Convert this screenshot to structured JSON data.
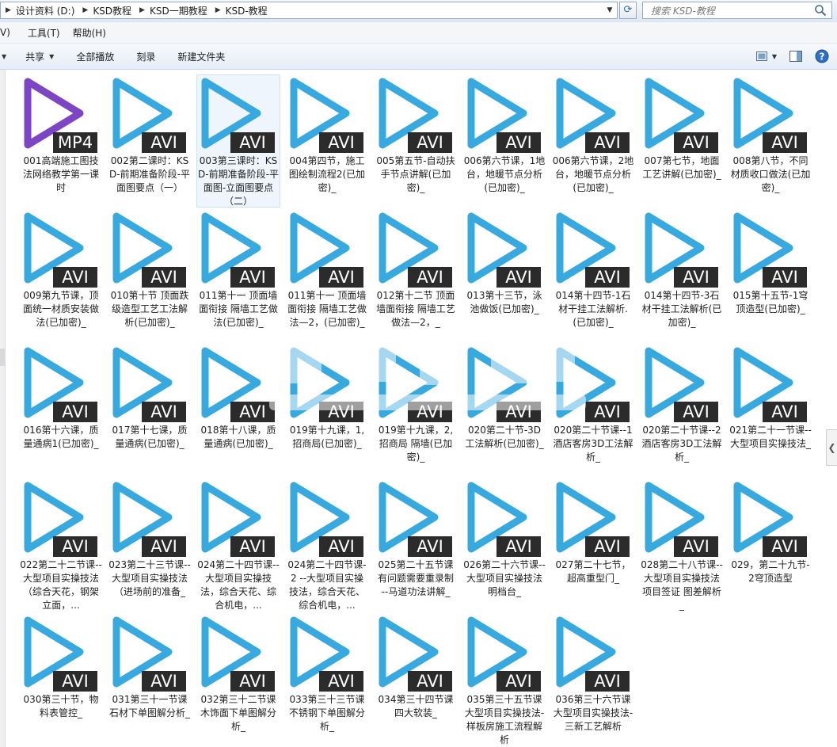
{
  "address": {
    "breadcrumbs": [
      "设计资料 (D:)",
      "KSD教程",
      "KSD一期教程",
      "KSD-教程"
    ]
  },
  "search": {
    "placeholder": "搜索 KSD-教程"
  },
  "menu": {
    "items": [
      "V)",
      "工具(T)",
      "帮助(H)"
    ]
  },
  "toolbar": {
    "share_label": "共享",
    "play_all_label": "全部播放",
    "burn_label": "刻录",
    "new_folder_label": "新建文件夹"
  },
  "colors": {
    "play_blue": "#38a9df",
    "mp4_purple": "#7b45c4",
    "badge_bg": "#2b2b2b"
  },
  "files": [
    {
      "name": "001高端施工图技法网络教学第一课时",
      "type": "MP4"
    },
    {
      "name": "002第二课时：KSD-前期准备阶段-平面图要点（一）",
      "type": "AVI"
    },
    {
      "name": "003第三课时：KSD-前期准备阶段-平面图-立面图要点（二）",
      "type": "AVI",
      "selected": true
    },
    {
      "name": "004第四节，施工图绘制流程2(已加密)_",
      "type": "AVI"
    },
    {
      "name": "005第五节-自动扶手节点讲解(已加密)_",
      "type": "AVI"
    },
    {
      "name": "006第六节课，1地台，地暖节点分析(已加密)_",
      "type": "AVI"
    },
    {
      "name": "006第六节课，2地台，地暖节点分析(已加密)_",
      "type": "AVI"
    },
    {
      "name": "007第七节，地面工艺讲解(已加密)_",
      "type": "AVI"
    },
    {
      "name": "008第八节，不同材质收口做法(已加密)_",
      "type": "AVI"
    },
    {
      "name": "009第九节课，顶面统一材质安装做法(已加密)_",
      "type": "AVI"
    },
    {
      "name": "010第十节 顶面跌级造型工艺工法解析(已加密)_",
      "type": "AVI"
    },
    {
      "name": "011第十一 顶面墙面衔接 隔墙工艺做法(已加密)_",
      "type": "AVI"
    },
    {
      "name": "011第十一 顶面墙面衔接 隔墙工艺做法—2，(已加密)_",
      "type": "AVI"
    },
    {
      "name": "012第十二节 顶面墙面衔接 隔墙工艺做法—2，_",
      "type": "AVI"
    },
    {
      "name": "013第十三节，泳池做饭(已加密)_",
      "type": "AVI"
    },
    {
      "name": "014第十四节-1石材干挂工法解析.(已加密)_",
      "type": "AVI"
    },
    {
      "name": "014第十四节-3石材干挂工法解析(已加密)_",
      "type": "AVI"
    },
    {
      "name": "015第十五节-1穹顶造型(已加密)_",
      "type": "AVI"
    },
    {
      "name": "016第十六课，质量通病1(已加密)_",
      "type": "AVI"
    },
    {
      "name": "017第十七课，质量通病(已加密)_",
      "type": "AVI"
    },
    {
      "name": "018第十八课，质量通病(已加密)_",
      "type": "AVI"
    },
    {
      "name": "019第十九课，1,招商局(已加密)_",
      "type": "AVI"
    },
    {
      "name": "019第十九课，2,招商局 隔墙(已加密)_",
      "type": "AVI"
    },
    {
      "name": "020第二十节-3D工法解析(已加密)_",
      "type": "AVI"
    },
    {
      "name": "020第二十节课--1酒店客房3D工法解析_",
      "type": "AVI"
    },
    {
      "name": "020第二十节课--2酒店客房3D工法解析_",
      "type": "AVI"
    },
    {
      "name": "021第二十一节课--大型项目实操技法_",
      "type": "AVI"
    },
    {
      "name": "022第二十二节课--大型项目实操技法（综合天花，钢架立面，...",
      "type": "AVI"
    },
    {
      "name": "023第二十三节课--大型项目实操技法（进场前的准备_",
      "type": "AVI"
    },
    {
      "name": "024第二十四节课--大型项目实操技法，综合天花、综合机电，...",
      "type": "AVI"
    },
    {
      "name": "024第二十四节课-2 --大型项目实操技法，综合天花、综合机电，...",
      "type": "AVI"
    },
    {
      "name": "025第二十五节课 有问题需要重录制 --马道功法讲解_",
      "type": "AVI"
    },
    {
      "name": "026第二十六节课--大型项目实操技法明档台_",
      "type": "AVI"
    },
    {
      "name": "027第二十七节，超高重型门_",
      "type": "AVI"
    },
    {
      "name": "028第二十八节课--大型项目实操技法项目签证 图差解析_",
      "type": "AVI"
    },
    {
      "name": "029，第二十九节-2穹顶造型",
      "type": "AVI"
    },
    {
      "name": "030第三十节，物料表管控_",
      "type": "AVI"
    },
    {
      "name": "031第三十一节课石材下单图解分析_",
      "type": "AVI"
    },
    {
      "name": "032第三十二节课木饰面下单图解分析_",
      "type": "AVI"
    },
    {
      "name": "033第三十三节课不锈钢下单图解分析_",
      "type": "AVI"
    },
    {
      "name": "034第三十四节课四大软装_",
      "type": "AVI"
    },
    {
      "name": "035第三十五节课大型项目实操技法-样板房施工流程解析",
      "type": "AVI"
    },
    {
      "name": "036第三十六节课大型项目实操技法-三新工艺解析",
      "type": "AVI"
    }
  ]
}
